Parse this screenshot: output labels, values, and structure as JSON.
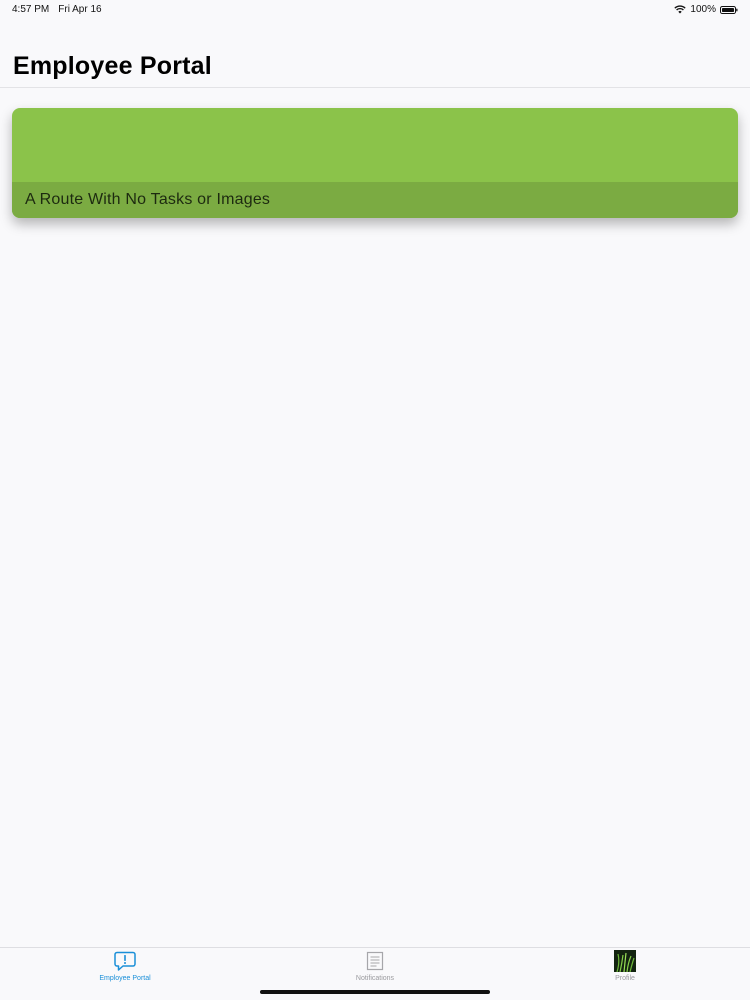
{
  "status_bar": {
    "time": "4:57 PM",
    "date": "Fri Apr 16",
    "battery": "100%"
  },
  "header": {
    "title": "Employee Portal"
  },
  "routes": [
    {
      "title": "A Route With No Tasks or Images",
      "color": "#8bc34a"
    }
  ],
  "tab_bar": {
    "tabs": [
      {
        "label": "Employee Portal",
        "icon": "message-alert-icon",
        "active": true
      },
      {
        "label": "Notifications",
        "icon": "document-icon",
        "active": false
      },
      {
        "label": "Profile",
        "icon": "profile-image",
        "active": false
      }
    ]
  },
  "colors": {
    "accent": "#1a8fd8",
    "card_green": "#8bc34a",
    "card_caption": "#7bab42"
  }
}
